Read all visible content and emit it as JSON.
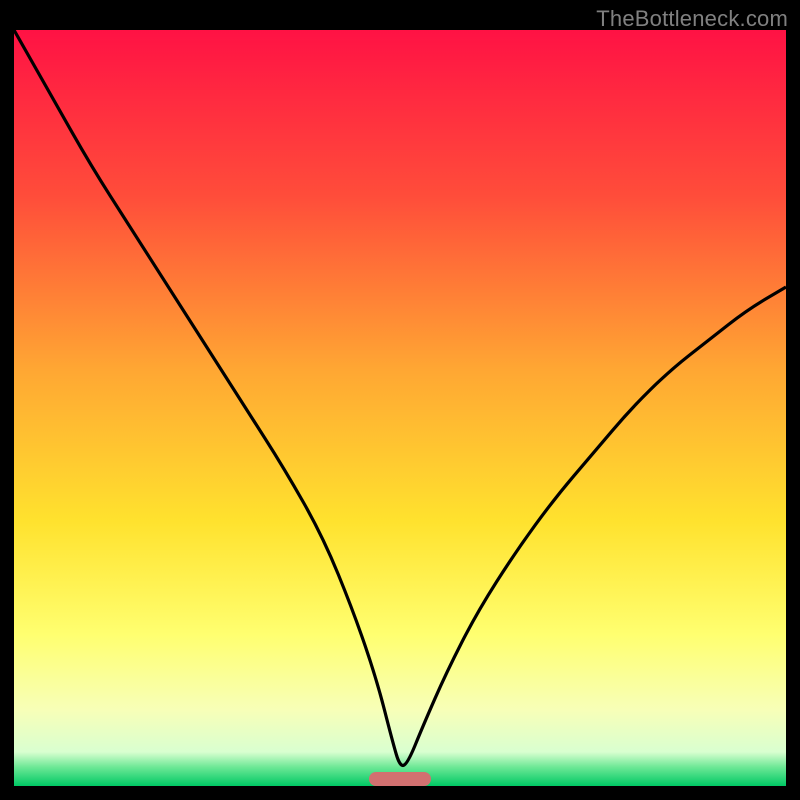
{
  "watermark": {
    "text": "TheBottleneck.com"
  },
  "chart_data": {
    "type": "line",
    "title": "",
    "xlabel": "",
    "ylabel": "",
    "xlim": [
      0,
      100
    ],
    "ylim": [
      0,
      100
    ],
    "series": [
      {
        "name": "bottleneck-curve",
        "x": [
          0,
          5,
          10,
          15,
          20,
          25,
          30,
          35,
          40,
          44,
          47,
          49,
          50,
          51,
          53,
          56,
          60,
          65,
          70,
          75,
          80,
          85,
          90,
          95,
          100
        ],
        "values": [
          100,
          91,
          82,
          74,
          66,
          58,
          50,
          42,
          33,
          23,
          14,
          6,
          2.5,
          3,
          8,
          15,
          23,
          31,
          38,
          44,
          50,
          55,
          59,
          63,
          66
        ]
      }
    ],
    "marker": {
      "x_center_pct": 50,
      "width_pct": 8
    },
    "gradient_stops": [
      {
        "offset": 0,
        "color": "#ff1244"
      },
      {
        "offset": 0.22,
        "color": "#ff4d3a"
      },
      {
        "offset": 0.45,
        "color": "#ffa733"
      },
      {
        "offset": 0.65,
        "color": "#ffe22e"
      },
      {
        "offset": 0.8,
        "color": "#ffff70"
      },
      {
        "offset": 0.9,
        "color": "#f7ffb8"
      },
      {
        "offset": 0.955,
        "color": "#d9ffd0"
      },
      {
        "offset": 0.975,
        "color": "#6de896"
      },
      {
        "offset": 1.0,
        "color": "#00c864"
      }
    ],
    "colors": {
      "curve_stroke": "#000000",
      "frame_bg": "#000000",
      "marker": "#d27070"
    }
  }
}
